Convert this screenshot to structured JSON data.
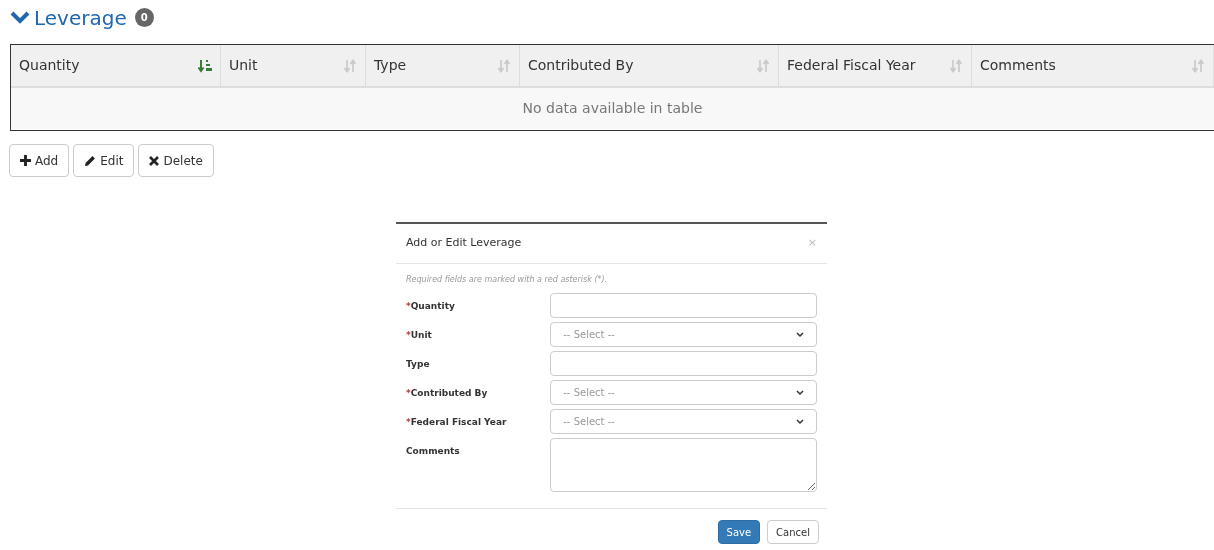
{
  "section": {
    "title": "Leverage",
    "count": "0",
    "expanded": true
  },
  "table": {
    "columns": [
      {
        "label": "Quantity",
        "sorted": true
      },
      {
        "label": "Unit",
        "sorted": false
      },
      {
        "label": "Type",
        "sorted": false
      },
      {
        "label": "Contributed By",
        "sorted": false
      },
      {
        "label": "Federal Fiscal Year",
        "sorted": false
      },
      {
        "label": "Comments",
        "sorted": false
      }
    ],
    "empty_message": "No data available in table"
  },
  "actions": [
    {
      "kind": "add",
      "label": "Add"
    },
    {
      "kind": "edit",
      "label": "Edit"
    },
    {
      "kind": "delete",
      "label": "Delete"
    }
  ],
  "dialog": {
    "title": "Add or Edit Leverage",
    "close": "×",
    "note": "Required fields are marked with a red asterisk (*).",
    "fields": [
      {
        "label": "Quantity",
        "required_mark": "*",
        "kind": "text"
      },
      {
        "label": "Unit",
        "required_mark": "*",
        "kind": "select",
        "placeholder": "-- Select --"
      },
      {
        "label": "Type",
        "kind": "text"
      },
      {
        "label": "Contributed By",
        "required_mark": "*",
        "kind": "select",
        "placeholder": "-- Select --"
      },
      {
        "label": "Federal Fiscal Year",
        "required_mark": "*",
        "kind": "select",
        "placeholder": "-- Select --"
      },
      {
        "label": "Comments",
        "kind": "textarea"
      }
    ],
    "buttons": [
      {
        "kind": "primary",
        "label": "Save"
      },
      {
        "kind": "default",
        "label": "Cancel"
      }
    ]
  }
}
